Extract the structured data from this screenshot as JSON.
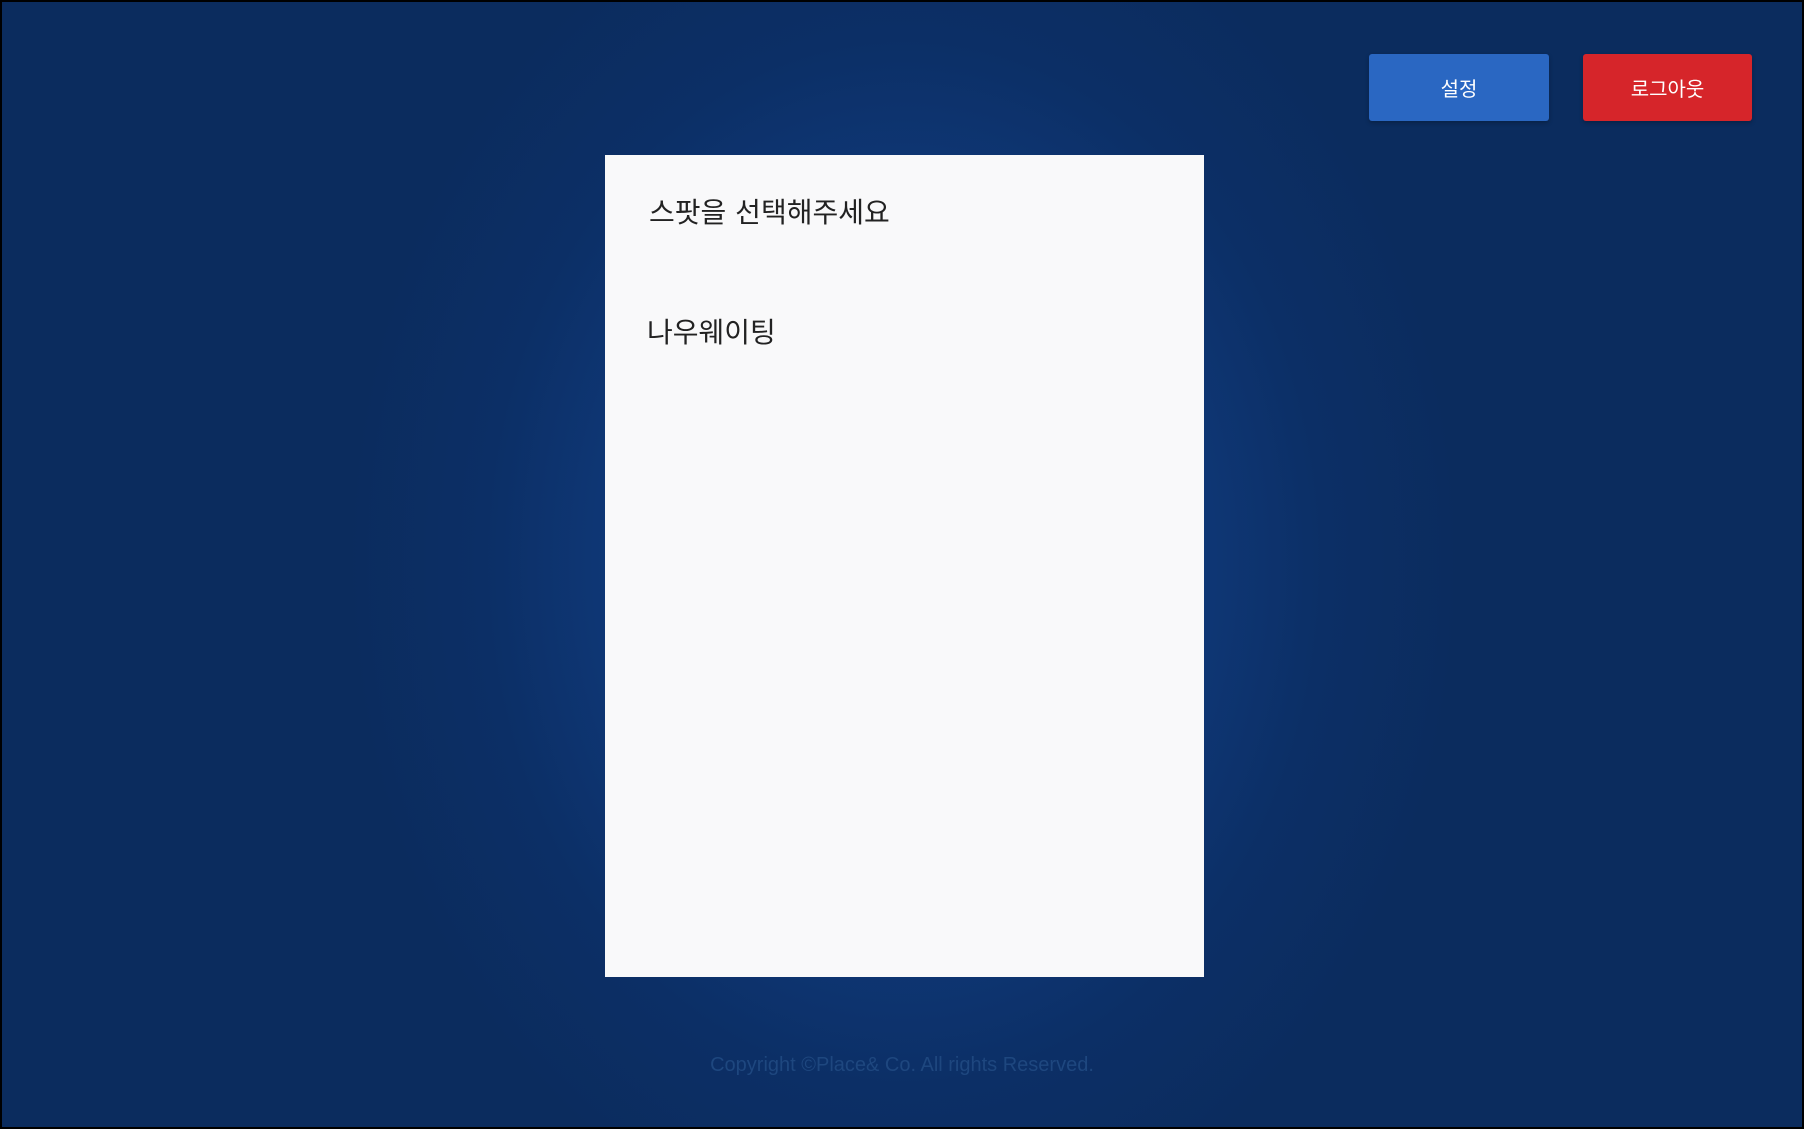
{
  "header": {
    "settings_label": "설정",
    "logout_label": "로그아웃"
  },
  "panel": {
    "title": "스팟을 선택해주세요",
    "spots": [
      {
        "label": "나우웨이팅"
      }
    ]
  },
  "footer": {
    "copyright": "Copyright ©Place& Co. All rights Reserved."
  },
  "colors": {
    "background": "#0f3a7b",
    "settings_button": "#2a67c2",
    "logout_button": "#d6252a",
    "panel": "#f9f9fa"
  }
}
